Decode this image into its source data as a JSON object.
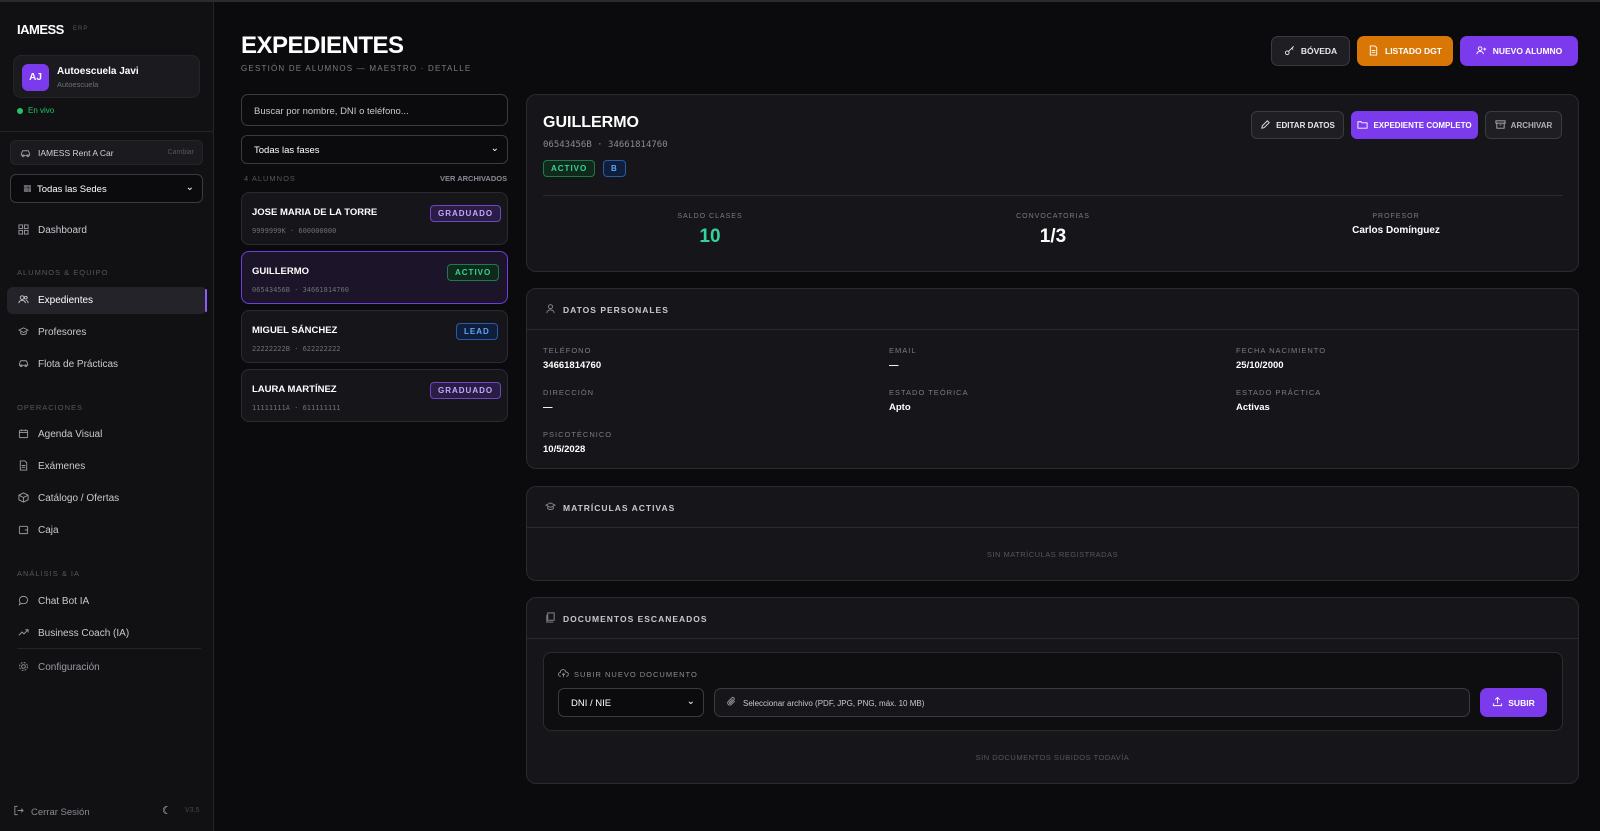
{
  "brand": {
    "logo": "IAMESS",
    "tag": "ERP"
  },
  "org": {
    "initials": "AJ",
    "name": "Autoescuela Javi",
    "type": "Autoescuela",
    "status": "En vivo"
  },
  "company": {
    "name": "IAMESS Rent A Car",
    "change": "Cambiar"
  },
  "sede": {
    "selected": "Todas las Sedes"
  },
  "nav": {
    "dashboard": "Dashboard",
    "section_team": "ALUMNOS & EQUIPO",
    "expedientes": "Expedientes",
    "profesores": "Profesores",
    "flota": "Flota de Prácticas",
    "section_ops": "OPERACIONES",
    "agenda": "Agenda Visual",
    "examenes": "Exámenes",
    "catalogo": "Catálogo / Ofertas",
    "caja": "Caja",
    "section_ai": "ANÁLISIS & IA",
    "chatbot": "Chat Bot IA",
    "coach": "Business Coach (IA)",
    "config": "Configuración",
    "logout": "Cerrar Sesión",
    "version": "V3.5"
  },
  "header": {
    "title": "EXPEDIENTES",
    "subtitle": "GESTIÓN DE ALUMNOS — MAESTRO · DETALLE",
    "boveda": "BÓVEDA",
    "dgt": "LISTADO DGT",
    "nuevo": "NUEVO ALUMNO"
  },
  "list": {
    "search_placeholder": "Buscar por nombre, DNI o teléfono...",
    "phase": "Todas las fases",
    "count": "4 ALUMNOS",
    "archived": "VER ARCHIVADOS",
    "students": [
      {
        "name": "JOSE MARIA DE LA TORRE",
        "meta": "9999999K · 600000000",
        "badge": "GRADUADO"
      },
      {
        "name": "GUILLERMO",
        "meta": "06543456B · 34661814760",
        "badge": "ACTIVO"
      },
      {
        "name": "MIGUEL SÁNCHEZ",
        "meta": "22222222B · 622222222",
        "badge": "LEAD"
      },
      {
        "name": "LAURA MARTÍNEZ",
        "meta": "11111111A · 611111111",
        "badge": "GRADUADO"
      }
    ]
  },
  "detail": {
    "name": "GUILLERMO",
    "meta": "06543456B · 34661814760",
    "status": "ACTIVO",
    "license": "B",
    "edit": "EDITAR DATOS",
    "full": "EXPEDIENTE COMPLETO",
    "archive": "ARCHIVAR",
    "stats": {
      "saldo_label": "SALDO CLASES",
      "saldo": "10",
      "conv_label": "CONVOCATORIAS",
      "conv": "1/3",
      "prof_label": "PROFESOR",
      "prof": "Carlos Domínguez"
    }
  },
  "personal": {
    "title": "DATOS PERSONALES",
    "tel_k": "TELÉFONO",
    "tel": "34661814760",
    "email_k": "EMAIL",
    "email": "—",
    "birth_k": "FECHA NACIMIENTO",
    "birth": "25/10/2000",
    "dir_k": "DIRECCIÓN",
    "dir": "—",
    "teo_k": "ESTADO TEÓRICA",
    "teo": "Apto",
    "prac_k": "ESTADO PRÁCTICA",
    "prac": "Activas",
    "psico_k": "PSICOTÉCNICO",
    "psico": "10/5/2028"
  },
  "enrollments": {
    "title": "MATRÍCULAS ACTIVAS",
    "empty": "SIN MATRÍCULAS REGISTRADAS"
  },
  "documents": {
    "title": "DOCUMENTOS ESCANEADOS",
    "upload_title": "SUBIR NUEVO DOCUMENTO",
    "doc_type": "DNI / NIE",
    "file_placeholder": "Seleccionar archivo (PDF, JPG, PNG, máx. 10 MB)",
    "submit": "SUBIR",
    "empty": "SIN DOCUMENTOS SUBIDOS TODAVÍA"
  },
  "colors": {
    "accent": "#7c3aed",
    "orange": "#d97706",
    "green": "#22c55e"
  }
}
